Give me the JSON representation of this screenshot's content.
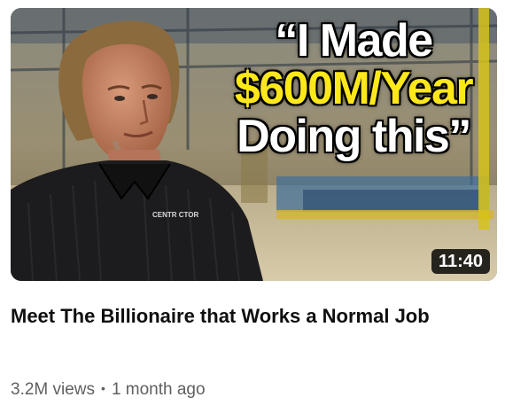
{
  "video": {
    "thumbnail": {
      "headline_line1": "“I Made",
      "headline_line2": "$600M/Year",
      "headline_line3": "Doing this”",
      "shirt_logo": "CENTR CTOR",
      "accent_yellow": "#ffe81a"
    },
    "duration": "11:40",
    "title": "Meet The Billionaire that Works a Normal Job",
    "views": "3.2M views",
    "separator": "•",
    "age": "1 month ago"
  }
}
